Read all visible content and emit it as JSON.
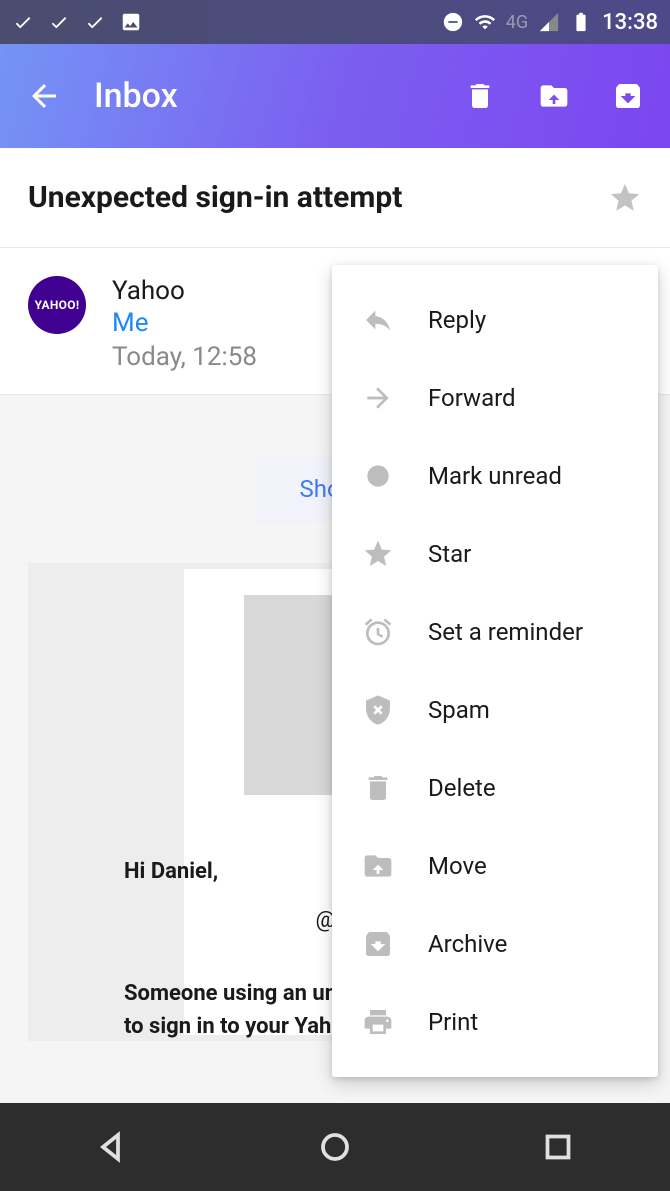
{
  "status": {
    "time": "13:38",
    "network": "4G"
  },
  "appbar": {
    "title": "Inbox"
  },
  "email": {
    "subject": "Unexpected sign-in attempt",
    "sender": "Yahoo",
    "avatar_text": "YAHOO!",
    "recipient": "Me",
    "timestamp": "Today, 12:58",
    "show_images_label": "Show i",
    "body_greeting": "Hi Daniel,",
    "body_email": "@yahoo.co",
    "body_line1": "Someone using an unr",
    "body_line2": "to sign in to your Yaho"
  },
  "menu": {
    "items": [
      {
        "label": "Reply",
        "icon": "reply"
      },
      {
        "label": "Forward",
        "icon": "forward"
      },
      {
        "label": "Mark unread",
        "icon": "circle"
      },
      {
        "label": "Star",
        "icon": "star"
      },
      {
        "label": "Set a reminder",
        "icon": "alarm"
      },
      {
        "label": "Spam",
        "icon": "shield"
      },
      {
        "label": "Delete",
        "icon": "trash"
      },
      {
        "label": "Move",
        "icon": "folder-up"
      },
      {
        "label": "Archive",
        "icon": "archive"
      },
      {
        "label": "Print",
        "icon": "print"
      }
    ]
  }
}
